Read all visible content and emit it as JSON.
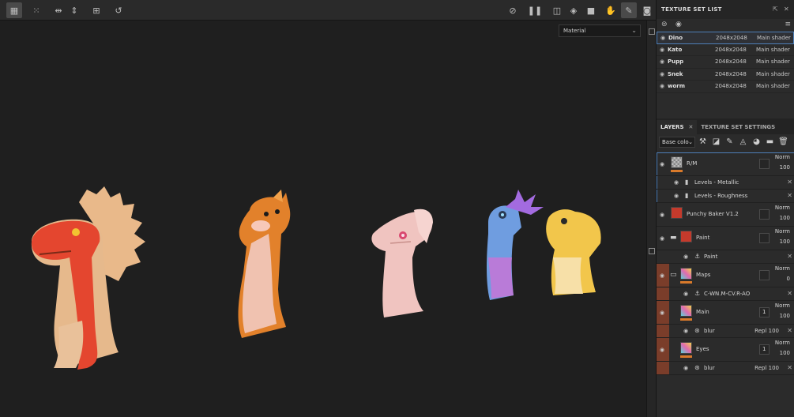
{
  "toolbar": {
    "left_icons": [
      "grid-icon",
      "grid-dots-icon",
      "mirror-x-icon",
      "mirror-y-icon",
      "frame-icon",
      "history-icon"
    ],
    "right_icons": [
      "hide-icon",
      "pause-icon",
      "split-view-icon",
      "cube-icon",
      "camera-icon",
      "hand-icon",
      "brush-icon",
      "screenshot-icon"
    ]
  },
  "viewport": {
    "material_dropdown": "Material"
  },
  "texture_set_list": {
    "title": "TEXTURE SET LIST",
    "rows": [
      {
        "name": "Dino",
        "res": "2048x2048",
        "shader": "Main shader"
      },
      {
        "name": "Kato",
        "res": "2048x2048",
        "shader": "Main shader"
      },
      {
        "name": "Pupp",
        "res": "2048x2048",
        "shader": "Main shader"
      },
      {
        "name": "Snek",
        "res": "2048x2048",
        "shader": "Main shader"
      },
      {
        "name": "worm",
        "res": "2048x2048",
        "shader": "Main shader"
      }
    ]
  },
  "tabs": {
    "layers": "LAYERS",
    "texture_set_settings": "TEXTURE SET SETTINGS"
  },
  "layer_tools": {
    "channel": "Base colo"
  },
  "layers": [
    {
      "name": "R/M",
      "blend": "Norm",
      "opacity": "100"
    },
    {
      "name": "Levels - Metallic"
    },
    {
      "name": "Levels - Roughness"
    },
    {
      "name": "Punchy Baker V1.2",
      "blend": "Norm",
      "opacity": "100"
    },
    {
      "name": "Paint",
      "blend": "Norm",
      "opacity": "100"
    },
    {
      "name": "Paint"
    },
    {
      "name": "Maps",
      "blend": "Norm",
      "opacity": "0"
    },
    {
      "name": "C-WN.M-CV.R-AO"
    },
    {
      "name": "Main",
      "blend": "Norm",
      "opacity": "100",
      "mask_num": "1"
    },
    {
      "name": "blur",
      "blend": "Repl",
      "opacity": "100"
    },
    {
      "name": "Eyes",
      "blend": "Norm",
      "opacity": "100",
      "mask_num": "1"
    },
    {
      "name": "blur",
      "blend": "Repl",
      "opacity": "100"
    }
  ],
  "colors": {
    "accent_orange": "#d97a2b",
    "selection_blue": "#4e7fb8",
    "panel_bg": "#2b2b2b",
    "viewport_bg": "#1f1f1f"
  }
}
